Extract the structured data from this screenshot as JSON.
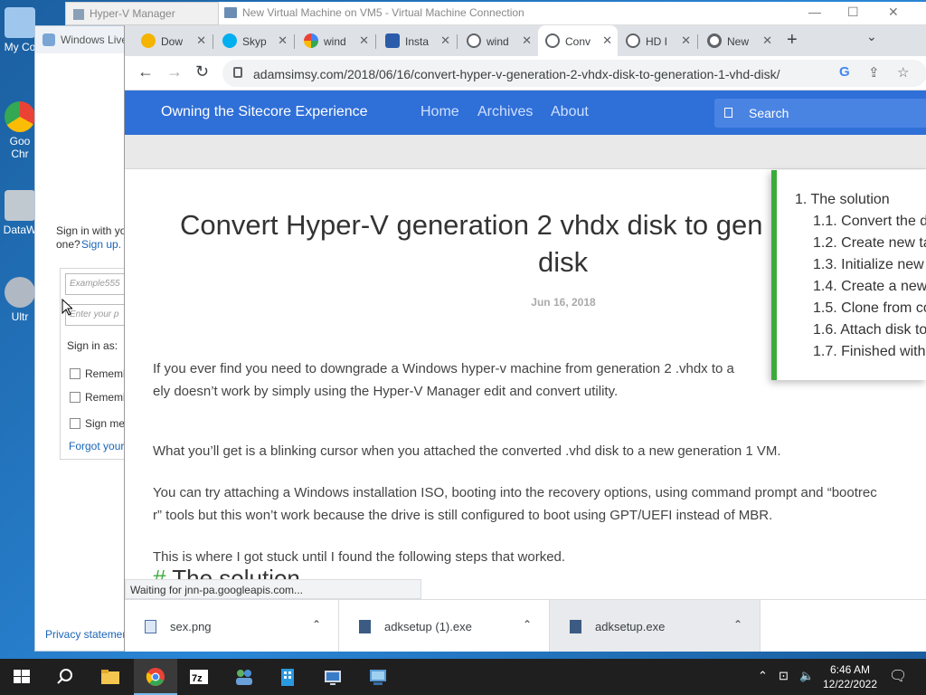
{
  "desktop": {
    "icons": [
      {
        "label": "My Co",
        "color": "#9fc7ee"
      },
      {
        "label": "Goo Chr",
        "color": "#ea4335"
      },
      {
        "label": "DataW",
        "color": "#c0c8d0"
      },
      {
        "label": "Ultr",
        "color": "#b0b8c4"
      }
    ]
  },
  "bg_windows": {
    "hyperv_title": "Hyper-V Manager",
    "vmc_title": "New Virtual Machine on VM5 - Virtual Machine Connection",
    "windows_live": {
      "title": "Windows Live",
      "sign_in_text": "Sign in with yo",
      "one_text": "one?",
      "sign_up": "Sign up.",
      "email_placeholder": "Example555",
      "password_placeholder": "Enter your p",
      "sign_in_as": "Sign in as:",
      "remember1": "Rememb",
      "remember2": "Rememb",
      "sign_me": "Sign me",
      "forgot": "Forgot your",
      "privacy": "Privacy statemen"
    }
  },
  "browser": {
    "tabs": [
      {
        "label": "Dow",
        "fav_color": "#f4b400"
      },
      {
        "label": "Skyp",
        "fav_color": "#00aff0"
      },
      {
        "label": "wind",
        "fav_color": "#4285f4"
      },
      {
        "label": "Insta",
        "fav_color": "#2a5caa"
      },
      {
        "label": "wind",
        "fav_color": "#5f6368"
      },
      {
        "label": "Conv",
        "fav_color": "#5f6368"
      },
      {
        "label": "HD I",
        "fav_color": "#5f6368"
      },
      {
        "label": "New",
        "fav_color": "#5f6368"
      }
    ],
    "url": "adamsimsy.com/2018/06/16/convert-hyper-v-generation-2-vhdx-disk-to-generation-1-vhd-disk/",
    "status": "Waiting for jnn-pa.googleapis.com..."
  },
  "site": {
    "brand": "Owning the Sitecore Experience",
    "nav": [
      "Home",
      "Archives",
      "About"
    ],
    "search_label": "Search"
  },
  "post": {
    "title_line1": "Convert Hyper-V generation 2 vhdx disk to gen",
    "title_line2": "disk",
    "date": "Jun 16, 2018",
    "p1_line1": "If you ever find you need to downgrade a Windows hyper-v machine from generation 2 .vhdx to a",
    "p1_line2": "ely doesn’t work by simply using the Hyper-V Manager edit and convert utility.",
    "p2": "What you’ll get is a blinking cursor when you attached the converted .vhd disk to a new generation 1 VM.",
    "p3_line1": "You can try attaching a Windows installation ISO, booting into the recovery options, using command prompt and “bootrec",
    "p3_line2": "r” tools but this won’t work because the drive is still configured to boot using GPT/UEFI instead of MBR.",
    "p4": "This is where I got stuck until I found the following steps that worked.",
    "h2_hash": "#",
    "h2": " The solution"
  },
  "toc": [
    "1. The solution",
    "1.1. Convert the d",
    "1.2. Create new ta",
    "1.3. Initialize new",
    "1.4. Create a new",
    "1.5. Clone from co",
    "1.6. Attach disk to",
    "1.7. Finished with"
  ],
  "downloads": [
    {
      "name": "sex.png"
    },
    {
      "name": "adksetup (1).exe"
    },
    {
      "name": "adksetup.exe"
    }
  ],
  "taskbar": {
    "time": "6:46 AM",
    "date": "12/22/2022"
  },
  "colors": {
    "site_blue": "#2f6fd8",
    "toc_green": "#3cab3c"
  }
}
